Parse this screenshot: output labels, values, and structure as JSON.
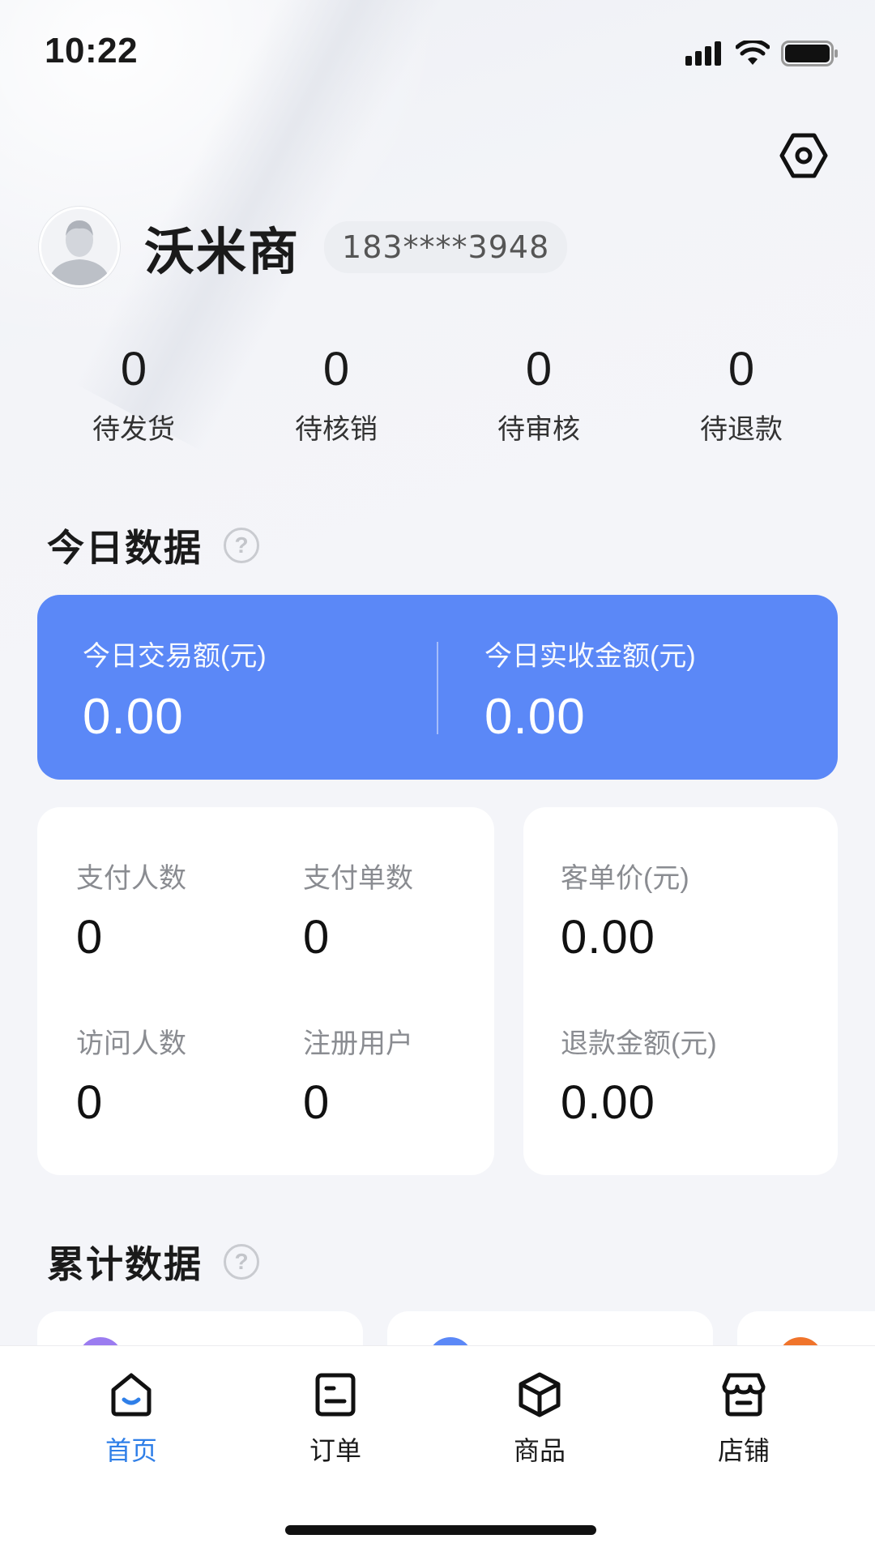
{
  "status_bar": {
    "time": "10:22"
  },
  "profile": {
    "name": "沃米商",
    "phone": "183****3948"
  },
  "order_stats": [
    {
      "value": "0",
      "label": "待发货"
    },
    {
      "value": "0",
      "label": "待核销"
    },
    {
      "value": "0",
      "label": "待审核"
    },
    {
      "value": "0",
      "label": "待退款"
    }
  ],
  "today": {
    "title": "今日数据",
    "trade_amount": {
      "label": "今日交易额(元)",
      "value": "0.00"
    },
    "received_amount": {
      "label": "今日实收金额(元)",
      "value": "0.00"
    },
    "metrics": {
      "pay_users": {
        "label": "支付人数",
        "value": "0"
      },
      "pay_orders": {
        "label": "支付单数",
        "value": "0"
      },
      "visitors": {
        "label": "访问人数",
        "value": "0"
      },
      "registered": {
        "label": "注册用户",
        "value": "0"
      },
      "avg_price": {
        "label": "客单价(元)",
        "value": "0.00"
      },
      "refund_amount": {
        "label": "退款金额(元)",
        "value": "0.00"
      }
    }
  },
  "cumulative": {
    "title": "累计数据"
  },
  "tabs": [
    {
      "label": "首页",
      "icon": "home-icon",
      "active": true
    },
    {
      "label": "订单",
      "icon": "order-icon",
      "active": false
    },
    {
      "label": "商品",
      "icon": "box-icon",
      "active": false
    },
    {
      "label": "店铺",
      "icon": "store-icon",
      "active": false
    }
  ],
  "colors": {
    "accent": "#2f7fe8",
    "card_blue": "#5b88f7"
  }
}
